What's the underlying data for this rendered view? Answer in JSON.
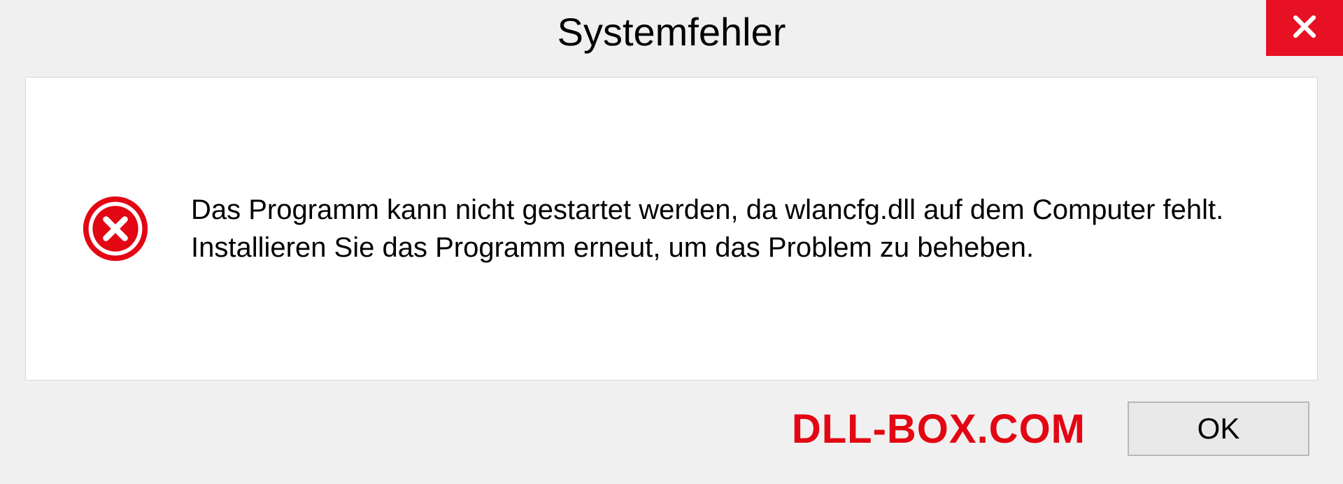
{
  "dialog": {
    "title": "Systemfehler",
    "message": "Das Programm kann nicht gestartet werden, da wlancfg.dll auf dem Computer fehlt. Installieren Sie das Programm erneut, um das Problem zu beheben.",
    "ok_label": "OK"
  },
  "watermark": "DLL-BOX.COM",
  "colors": {
    "close_bg": "#e81123",
    "error_icon": "#e30613",
    "watermark": "#e30613"
  }
}
